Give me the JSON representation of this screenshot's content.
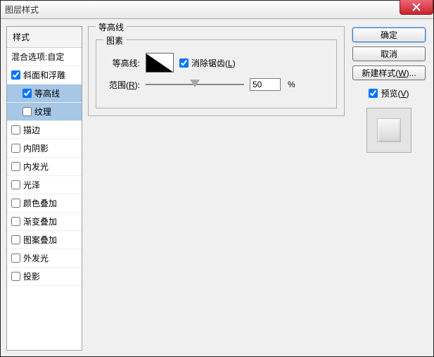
{
  "window": {
    "title": "图层样式"
  },
  "left": {
    "header": "样式",
    "blend": "混合选项:自定",
    "items": [
      {
        "label": "斜面和浮雕",
        "checked": true,
        "selected": false,
        "indent": false
      },
      {
        "label": "等高线",
        "checked": true,
        "selected": true,
        "indent": true
      },
      {
        "label": "纹理",
        "checked": false,
        "selected": true,
        "indent": true
      },
      {
        "label": "描边",
        "checked": false,
        "selected": false,
        "indent": false
      },
      {
        "label": "内阴影",
        "checked": false,
        "selected": false,
        "indent": false
      },
      {
        "label": "内发光",
        "checked": false,
        "selected": false,
        "indent": false
      },
      {
        "label": "光泽",
        "checked": false,
        "selected": false,
        "indent": false
      },
      {
        "label": "颜色叠加",
        "checked": false,
        "selected": false,
        "indent": false
      },
      {
        "label": "渐变叠加",
        "checked": false,
        "selected": false,
        "indent": false
      },
      {
        "label": "图案叠加",
        "checked": false,
        "selected": false,
        "indent": false
      },
      {
        "label": "外发光",
        "checked": false,
        "selected": false,
        "indent": false
      },
      {
        "label": "投影",
        "checked": false,
        "selected": false,
        "indent": false
      }
    ]
  },
  "middle": {
    "section_title": "等高线",
    "subsection_title": "图素",
    "contour_label": "等高线:",
    "antialias_label": "消除锯齿(",
    "antialias_hotkey": "L",
    "antialias_suffix": ")",
    "antialias_checked": true,
    "range_label": "范围(",
    "range_hotkey": "R",
    "range_suffix": "):",
    "range_value": "50",
    "range_unit": "%"
  },
  "right": {
    "ok": "确定",
    "cancel": "取消",
    "new_style": "新建样式(",
    "new_style_hotkey": "W",
    "new_style_suffix": ")...",
    "preview_label": "预览(",
    "preview_hotkey": "V",
    "preview_suffix": ")",
    "preview_checked": true
  }
}
